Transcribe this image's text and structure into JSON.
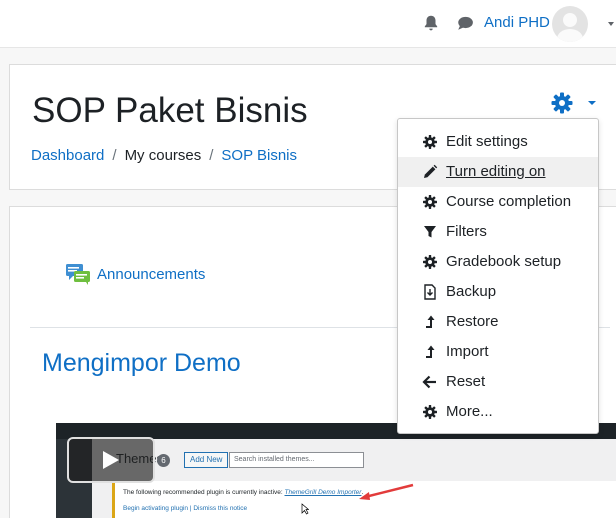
{
  "navbar": {
    "user_name": "Andi PHD",
    "icons": [
      "bell-icon",
      "chat-bubble-icon",
      "chevron-down-icon"
    ]
  },
  "header": {
    "title": "SOP Paket Bisnis",
    "breadcrumb": [
      "Dashboard",
      "My courses",
      "SOP Bisnis"
    ]
  },
  "settings_menu": {
    "items": [
      {
        "label": "Edit settings",
        "icon": "gear-icon"
      },
      {
        "label": "Turn editing on",
        "icon": "pencil-icon"
      },
      {
        "label": "Course completion",
        "icon": "gear-icon"
      },
      {
        "label": "Filters",
        "icon": "filter-icon"
      },
      {
        "label": "Gradebook setup",
        "icon": "gear-icon"
      },
      {
        "label": "Backup",
        "icon": "file-download-icon"
      },
      {
        "label": "Restore",
        "icon": "level-up-icon"
      },
      {
        "label": "Import",
        "icon": "level-up-icon"
      },
      {
        "label": "Reset",
        "icon": "arrow-left-icon"
      },
      {
        "label": "More...",
        "icon": "gear-icon"
      }
    ]
  },
  "content": {
    "announcement_label": "Announcements",
    "section_title": "Mengimpor Demo"
  },
  "video": {
    "wp_title": "Themes",
    "wp_count": "6",
    "wp_add_new": "Add New",
    "wp_search_placeholder": "Search installed themes...",
    "wp_notice_prefix": "The following recommended plugin is currently inactive: ",
    "wp_notice_link": "ThemeGrill Demo Importer",
    "wp_notice_suffix": ".",
    "wp_notice_actions": "Begin activating plugin | Dismiss this notice"
  },
  "colors": {
    "link": "#0f6fc5",
    "text": "#1d2125"
  }
}
